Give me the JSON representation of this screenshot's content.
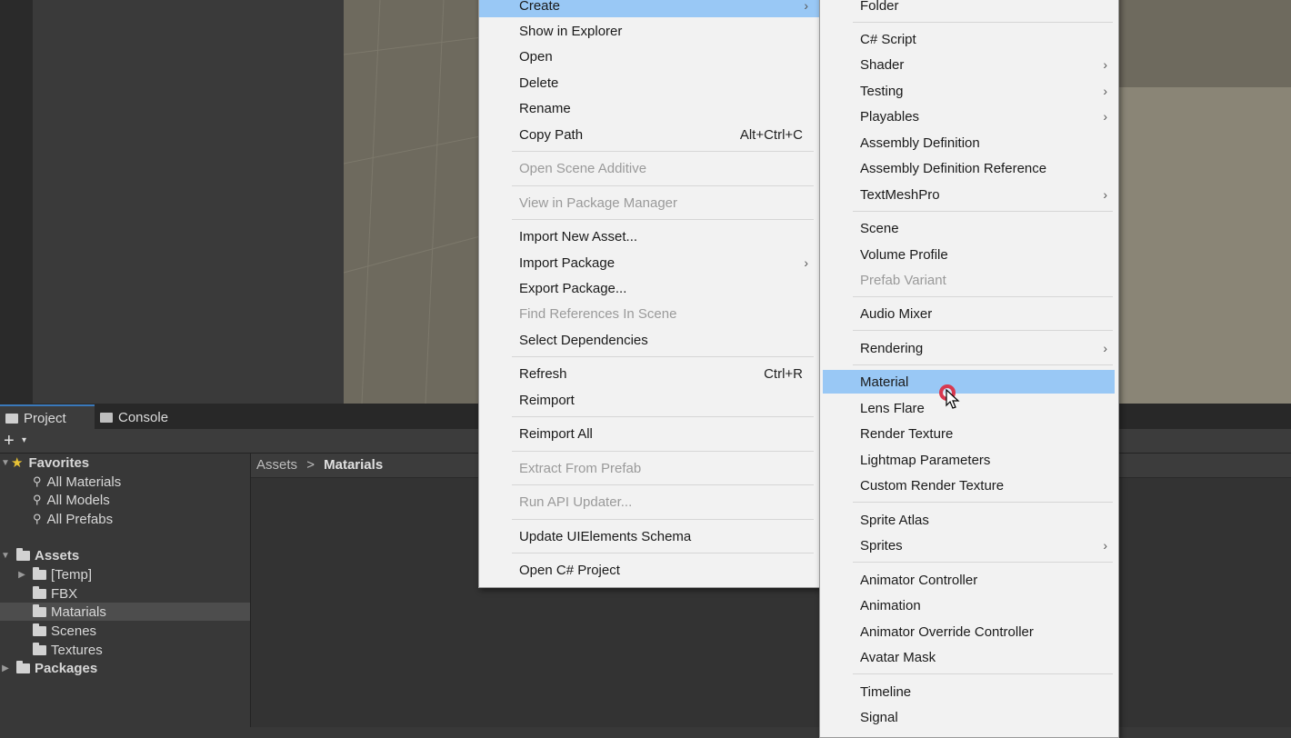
{
  "tabs": {
    "project": "Project",
    "console": "Console"
  },
  "toolbar": {
    "add": "+",
    "caret": "▾"
  },
  "tree": {
    "favorites": {
      "label": "Favorites",
      "items": [
        "All Materials",
        "All Models",
        "All Prefabs"
      ]
    },
    "assets": {
      "label": "Assets",
      "children": [
        "[Temp]",
        "FBX",
        "Matarials",
        "Scenes",
        "Textures"
      ]
    },
    "packages": {
      "label": "Packages"
    }
  },
  "breadcrumb": {
    "root": "Assets",
    "sep": ">",
    "current": "Matarials"
  },
  "context_menu": {
    "create": "Create",
    "show_in_explorer": "Show in Explorer",
    "open": "Open",
    "delete": "Delete",
    "rename": "Rename",
    "copy_path": "Copy Path",
    "copy_path_shortcut": "Alt+Ctrl+C",
    "open_scene_additive": "Open Scene Additive",
    "view_in_package_manager": "View in Package Manager",
    "import_new_asset": "Import New Asset...",
    "import_package": "Import Package",
    "export_package": "Export Package...",
    "find_references": "Find References In Scene",
    "select_dependencies": "Select Dependencies",
    "refresh": "Refresh",
    "refresh_shortcut": "Ctrl+R",
    "reimport": "Reimport",
    "reimport_all": "Reimport All",
    "extract_from_prefab": "Extract From Prefab",
    "run_api_updater": "Run API Updater...",
    "update_uielements": "Update UIElements Schema",
    "open_csharp_project": "Open C# Project"
  },
  "create_menu": {
    "folder": "Folder",
    "csharp_script": "C# Script",
    "shader": "Shader",
    "testing": "Testing",
    "playables": "Playables",
    "assembly_definition": "Assembly Definition",
    "assembly_definition_reference": "Assembly Definition Reference",
    "textmeshpro": "TextMeshPro",
    "scene": "Scene",
    "volume_profile": "Volume Profile",
    "prefab_variant": "Prefab Variant",
    "audio_mixer": "Audio Mixer",
    "rendering": "Rendering",
    "material": "Material",
    "lens_flare": "Lens Flare",
    "render_texture": "Render Texture",
    "lightmap_parameters": "Lightmap Parameters",
    "custom_render_texture": "Custom Render Texture",
    "sprite_atlas": "Sprite Atlas",
    "sprites": "Sprites",
    "animator_controller": "Animator Controller",
    "animation": "Animation",
    "animator_override_controller": "Animator Override Controller",
    "avatar_mask": "Avatar Mask",
    "timeline": "Timeline",
    "signal": "Signal"
  },
  "colors": {
    "highlight": "#99c8f5",
    "menu_bg": "#f2f2f2",
    "panel_bg": "#383838",
    "scene_bg": "#6e6a5e",
    "click_ring": "#d8384f"
  }
}
